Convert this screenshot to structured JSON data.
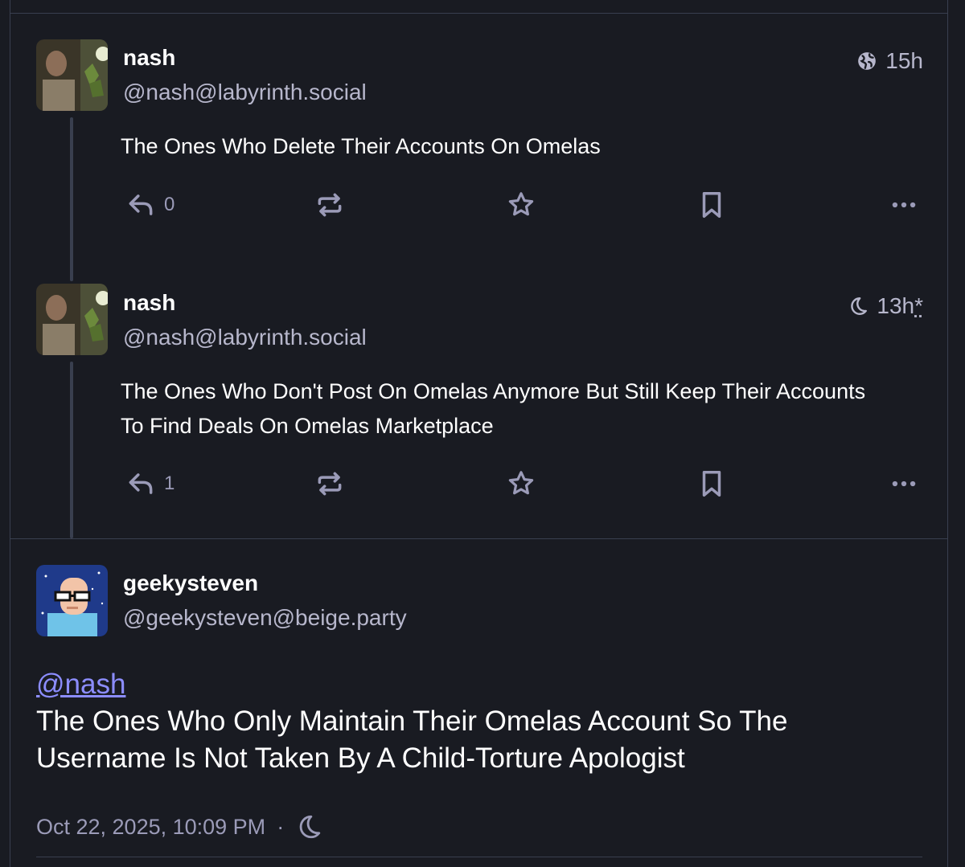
{
  "posts": [
    {
      "display_name": "nash",
      "handle": "@nash@labyrinth.social",
      "visibility_icon": "globe-icon",
      "time": "15h",
      "time_suffix": "",
      "content": "The Ones Who Delete Their Accounts On Omelas",
      "reply_count": "0"
    },
    {
      "display_name": "nash",
      "handle": "@nash@labyrinth.social",
      "visibility_icon": "moon-icon",
      "time": "13h",
      "time_suffix": "*",
      "content_line1": "The Ones Who Don't Post On Omelas Anymore But Still Keep Their Accounts",
      "content_line2": "To Find Deals On Omelas Marketplace",
      "reply_count": "1"
    }
  ],
  "focused_post": {
    "display_name": "geekysteven",
    "handle": "@geekysteven@beige.party",
    "mention": "@nash",
    "content_line1": "The Ones Who Only Maintain Their Omelas Account So The",
    "content_line2": "Username Is Not Taken By A Child-Torture Apologist",
    "timestamp": "Oct 22, 2025, 10:09 PM",
    "separator": "·",
    "visibility_icon": "moon-icon"
  },
  "colors": {
    "background": "#191b22",
    "border": "#393f4f",
    "muted_text": "#9b9bb8",
    "mention": "#8c8dff"
  }
}
